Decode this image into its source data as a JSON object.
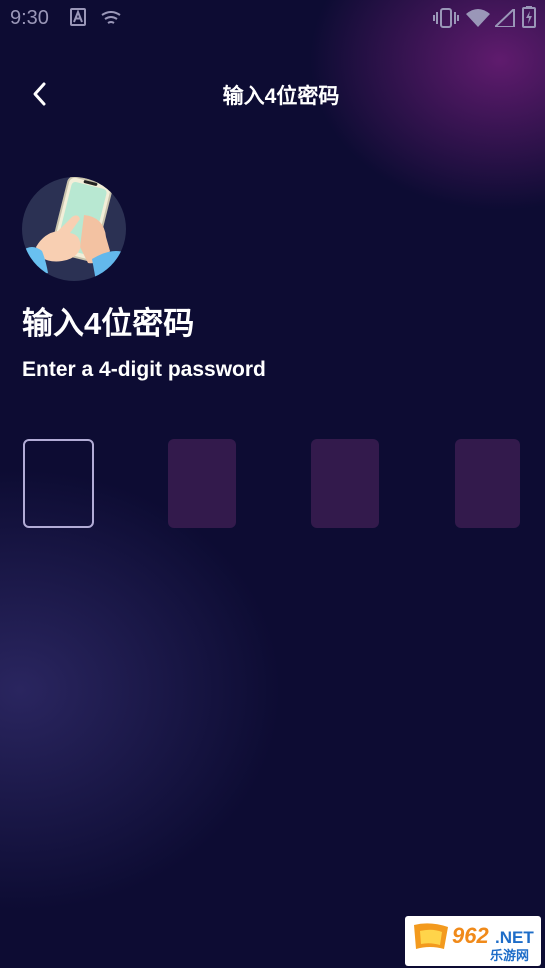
{
  "status_bar": {
    "time": "9:30",
    "left_icons": [
      "a-notification-icon",
      "signal-notification-icon"
    ],
    "right_icons": [
      "vibrate-icon",
      "wifi-icon",
      "cell-signal-icon",
      "battery-icon"
    ]
  },
  "header": {
    "back_icon": "chevron-left-icon",
    "title": "输入4位密码"
  },
  "main": {
    "avatar_icon": "hand-holding-phone-illustration",
    "heading": "输入4位密码",
    "subheading": "Enter a 4-digit password",
    "pin_boxes": [
      {
        "value": "",
        "state": "focused"
      },
      {
        "value": "",
        "state": "empty"
      },
      {
        "value": "",
        "state": "empty"
      },
      {
        "value": "",
        "state": "empty"
      }
    ]
  },
  "watermark": {
    "brand": "962.NET",
    "subtitle": "乐游网"
  },
  "colors": {
    "background": "#0d0c33",
    "box_empty": "#331a4c",
    "box_focus_border": "#b2acd6",
    "text": "#ffffff"
  }
}
